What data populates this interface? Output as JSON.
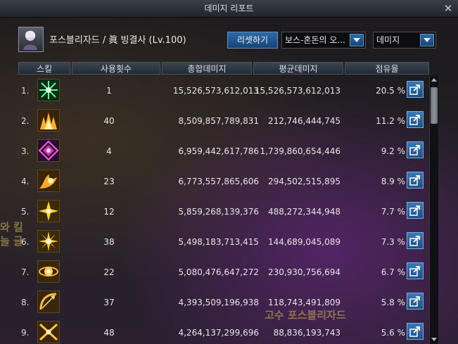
{
  "window": {
    "title": "데미지 리포트"
  },
  "character": {
    "name_line": "포스블리자드 / 眞 빙결사 (Lv.100)"
  },
  "controls": {
    "reset_label": "리셋하기",
    "target_selected": "보스-혼돈의 오...",
    "metric_selected": "데미지"
  },
  "table": {
    "headers": [
      "스킬",
      "사용횟수",
      "총합데미지",
      "평균데미지",
      "점유율"
    ],
    "rows": [
      {
        "rank": "1.",
        "uses": "1",
        "total": "15,526,573,612,013",
        "avg": "15,526,573,612,013",
        "share": "20.5 %",
        "icon": "green-burst-icon"
      },
      {
        "rank": "2.",
        "uses": "40",
        "total": "8,509,857,789,831",
        "avg": "212,746,444,745",
        "share": "11.2 %",
        "icon": "fire-spike-icon"
      },
      {
        "rank": "3.",
        "uses": "4",
        "total": "6,959,442,617,786",
        "avg": "1,739,860,654,446",
        "share": "9.2 %",
        "icon": "magenta-diamond-icon"
      },
      {
        "rank": "4.",
        "uses": "23",
        "total": "6,773,557,865,606",
        "avg": "294,502,515,895",
        "share": "8.9 %",
        "icon": "flame-wave-icon"
      },
      {
        "rank": "5.",
        "uses": "12",
        "total": "5,859,268,139,376",
        "avg": "488,272,344,948",
        "share": "7.7 %",
        "icon": "star-flare-icon"
      },
      {
        "rank": "6.",
        "uses": "38",
        "total": "5,498,183,713,415",
        "avg": "144,689,045,089",
        "share": "7.3 %",
        "icon": "sun-burst-icon"
      },
      {
        "rank": "7.",
        "uses": "22",
        "total": "5,080,476,647,272",
        "avg": "230,930,756,694",
        "share": "6.7 %",
        "icon": "orb-blast-icon"
      },
      {
        "rank": "8.",
        "uses": "37",
        "total": "4,393,509,196,938",
        "avg": "118,743,491,809",
        "share": "5.8 %",
        "icon": "bow-arc-icon"
      },
      {
        "rank": "9.",
        "uses": "48",
        "total": "4,264,137,299,696",
        "avg": "88,836,193,743",
        "share": "5.6 %",
        "icon": "cross-slash-icon"
      }
    ]
  },
  "background_text": {
    "player_name": "고수 포스블리자드",
    "edge_line_1": "와 킬",
    "edge_line_2": "늘 글"
  },
  "colors": {
    "accent_blue": "#2d6aa5",
    "icon_frame": "#5a4a22",
    "text": "#e6e6e6"
  }
}
